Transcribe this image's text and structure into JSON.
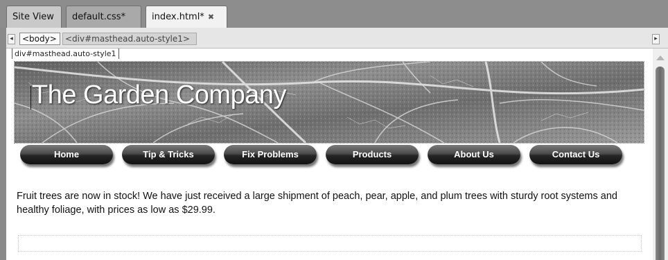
{
  "tabs": [
    {
      "label": "Site View",
      "active": false
    },
    {
      "label": "default.css*",
      "active": false
    },
    {
      "label": "index.html*",
      "active": true
    }
  ],
  "tag_selector": {
    "body_tag": "<body>",
    "div_tag": "<div#masthead.auto-style1>"
  },
  "design": {
    "div_label": "div#masthead.auto-style1",
    "masthead_title": "The Garden Company",
    "nav": [
      "Home",
      "Tip & Tricks",
      "Fix Problems",
      "Products",
      "About Us",
      "Contact Us"
    ],
    "paragraph": "Fruit trees are now in stock! We have just received a large shipment of peach, pear, apple, and plum trees with sturdy root systems and healthy foliage, with prices as low as $29.99."
  },
  "icons": {
    "tab_close": "close-icon",
    "scroll_left": "triangle-left-icon",
    "scroll_right": "triangle-right-icon",
    "scroll_up": "triangle-up-icon"
  },
  "colors": {
    "tab_bar_bg": "#8d8d8d",
    "active_tab": "#f2f2f2",
    "nav_button": "#2a2a2a",
    "masthead_text": "#ffffff"
  }
}
